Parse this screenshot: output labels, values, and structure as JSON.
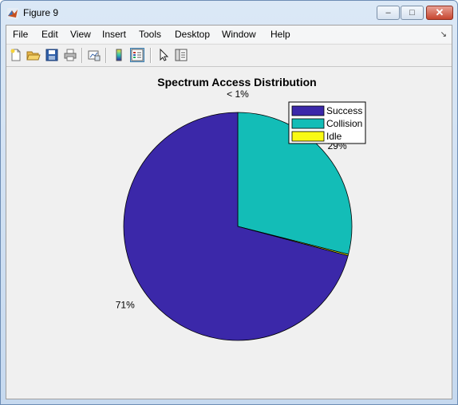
{
  "window": {
    "title": "Figure 9",
    "controls": {
      "minimize": "–",
      "maximize": "□",
      "close": "✕"
    }
  },
  "menubar": {
    "items": [
      "File",
      "Edit",
      "View",
      "Insert",
      "Tools",
      "Desktop",
      "Window",
      "Help"
    ]
  },
  "toolbar": {
    "buttons": [
      "new-figure-icon",
      "open-file-icon",
      "save-icon",
      "print-icon",
      "link-plot-icon",
      "colorbar-icon",
      "legend-icon",
      "pointer-icon",
      "property-editor-icon"
    ]
  },
  "chart_data": {
    "type": "pie",
    "title": "Spectrum Access Distribution",
    "slices": [
      {
        "name": "Success",
        "value": 71,
        "label": "71%",
        "color": "#3b28a9"
      },
      {
        "name": "Collision",
        "value": 29,
        "label": "29%",
        "color": "#13bdb7"
      },
      {
        "name": "Idle",
        "value": 0.2,
        "label": "< 1%",
        "color": "#f9fa14"
      }
    ],
    "legend": {
      "position": "top-right",
      "entries": [
        "Success",
        "Collision",
        "Idle"
      ]
    },
    "start": "top",
    "direction": "clockwise"
  }
}
